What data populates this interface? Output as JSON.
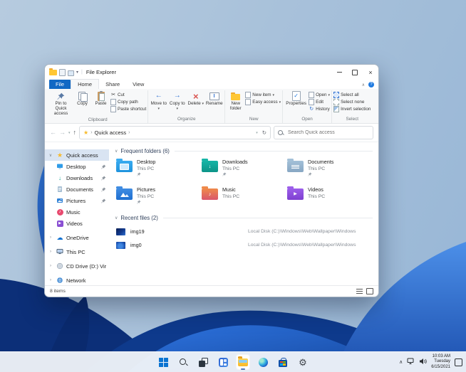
{
  "glyphs": {
    "caret_down": "▾",
    "chevron_expanded": "∨",
    "chevron_collapsed": "›",
    "chevron_up": "∧",
    "breadcrumb_chevron": "›",
    "back_arrow": "←",
    "forward_arrow": "→",
    "up_arrow": "↑",
    "down_arrow": "↓",
    "refresh": "↻",
    "history": "↻",
    "close": "×",
    "help": "?",
    "star": "★",
    "cloud": "☁",
    "music_note": "♪",
    "play": "▶",
    "check": "✓",
    "scissors": "✂",
    "delete_x": "×",
    "gear": "⚙",
    "pipe": "|"
  },
  "explorer": {
    "title": "File Explorer",
    "tabs": {
      "file": "File",
      "home": "Home",
      "share": "Share",
      "view": "View"
    },
    "ribbon": {
      "groups": {
        "clipboard": "Clipboard",
        "organize": "Organize",
        "new": "New",
        "open": "Open",
        "select": "Select"
      },
      "pin_to_quick_access": "Pin to Quick access",
      "copy": "Copy",
      "paste": "Paste",
      "cut": "Cut",
      "copy_path": "Copy path",
      "paste_shortcut": "Paste shortcut",
      "move_to": "Move to",
      "copy_to": "Copy to",
      "delete": "Delete",
      "rename": "Rename",
      "new_folder": "New folder",
      "new_item": "New item",
      "easy_access": "Easy access",
      "properties": "Properties",
      "open": "Open",
      "edit": "Edit",
      "history": "History",
      "select_all": "Select all",
      "select_none": "Select none",
      "invert_selection": "Invert selection"
    },
    "address": {
      "crumb": "Quick access",
      "search_placeholder": "Search Quick access"
    },
    "sidebar": [
      {
        "label": "Quick access"
      },
      {
        "label": "Desktop"
      },
      {
        "label": "Downloads"
      },
      {
        "label": "Documents"
      },
      {
        "label": "Pictures"
      },
      {
        "label": "Music"
      },
      {
        "label": "Videos"
      },
      {
        "label": "OneDrive"
      },
      {
        "label": "This PC"
      },
      {
        "label": "CD Drive (D:) Virtual"
      },
      {
        "label": "Network"
      }
    ],
    "content": {
      "frequent_header": "Frequent folders (6)",
      "folders": [
        {
          "name": "Desktop",
          "location": "This PC",
          "pinned": true
        },
        {
          "name": "Downloads",
          "location": "This PC",
          "pinned": true
        },
        {
          "name": "Documents",
          "location": "This PC",
          "pinned": true
        },
        {
          "name": "Pictures",
          "location": "This PC",
          "pinned": true
        },
        {
          "name": "Music",
          "location": "This PC",
          "pinned": false
        },
        {
          "name": "Videos",
          "location": "This PC",
          "pinned": false
        }
      ],
      "recent_header": "Recent files (2)",
      "recent": [
        {
          "name": "img19",
          "path": "Local Disk (C:)\\Windows\\Web\\Wallpaper\\Windows"
        },
        {
          "name": "img0",
          "path": "Local Disk (C:)\\Windows\\Web\\Wallpaper\\Windows"
        }
      ]
    },
    "status_text": "8 items"
  },
  "taskbar": {
    "tray": {
      "time": "10:03 AM",
      "day": "Tuesday",
      "date": "6/15/2021"
    }
  }
}
